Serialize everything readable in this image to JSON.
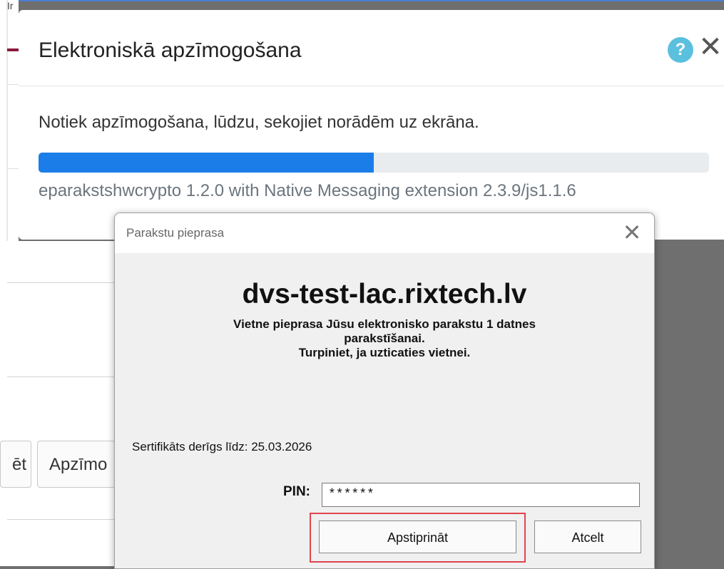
{
  "background": {
    "partial_top_text": "Ir",
    "button_1_label": "ēt",
    "button_2_label": "Apzīmo"
  },
  "modal": {
    "title": "Elektroniskā apzīmogošana",
    "help_icon": "?",
    "close_icon": "✕",
    "message": "Notiek apzīmogošana, lūdzu, sekojiet norādēm uz ekrāna.",
    "progress": 0.5,
    "version": "eparakstshwcrypto 1.2.0 with Native Messaging extension 2.3.9/js1.1.6",
    "progress_color": "#1b7ee8"
  },
  "dialog": {
    "title": "Parakstu pieprasa",
    "close_icon": "✕",
    "host": "dvs-test-lac.rixtech.lv",
    "description_lines": [
      "Vietne pieprasa Jūsu elektronisko parakstu 1 datnes",
      "parakstīšanai.",
      "Turpiniet, ja uzticaties vietnei."
    ],
    "certificate": "Sertifikāts derīgs līdz: 25.03.2026",
    "pin_label": "PIN:",
    "pin_value": "******",
    "confirm_label": "Apstiprināt",
    "cancel_label": "Atcelt",
    "highlight_color": "#e0444e"
  }
}
